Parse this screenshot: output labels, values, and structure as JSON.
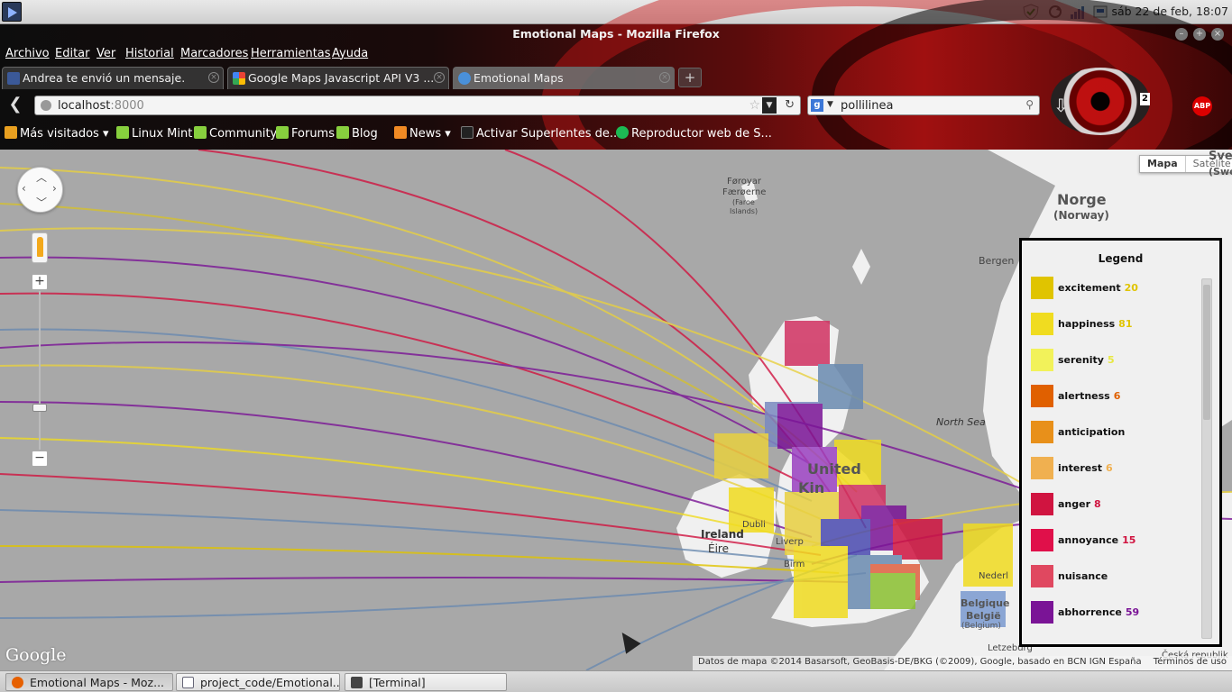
{
  "system": {
    "clock": "sáb 22 de feb, 18:07",
    "icons": [
      "mintmenu-icon",
      "shield-icon",
      "update-icon",
      "network-icon",
      "removable-drive-icon"
    ]
  },
  "window": {
    "title": "Emotional Maps - Mozilla Firefox"
  },
  "menubar": {
    "items": [
      "Archivo",
      "Editar",
      "Ver",
      "Historial",
      "Marcadores",
      "Herramientas",
      "Ayuda"
    ]
  },
  "tabs": [
    {
      "label": "Andrea te envió un mensaje.",
      "icon": "facebook-icon",
      "color": "#3b5998"
    },
    {
      "label": "Google Maps Javascript API V3 ...",
      "icon": "google-icon",
      "color": "#e8e8e8"
    },
    {
      "label": "Emotional Maps",
      "icon": "globe-icon",
      "color": "#4a90d9"
    }
  ],
  "newtab_label": "+",
  "navbar": {
    "url_host": "localhost",
    "url_port": ":8000",
    "search_value": "pollilinea",
    "search_engine": "g"
  },
  "bookmarks": [
    {
      "label": "Más visitados",
      "icon": "folder-icon",
      "color": "#e8a020",
      "dropdown": true
    },
    {
      "label": "Linux Mint",
      "icon": "mint-icon",
      "color": "#87cf3e"
    },
    {
      "label": "Community",
      "icon": "mint-icon",
      "color": "#87cf3e"
    },
    {
      "label": "Forums",
      "icon": "mint-icon",
      "color": "#87cf3e"
    },
    {
      "label": "Blog",
      "icon": "mint-icon",
      "color": "#87cf3e"
    },
    {
      "label": "News",
      "icon": "rss-icon",
      "color": "#f08a24",
      "dropdown": true
    },
    {
      "label": "Activar Superlentes de...",
      "icon": "page-icon",
      "color": "#222"
    },
    {
      "label": "Reproductor web de S...",
      "icon": "spotify-icon",
      "color": "#1db954"
    }
  ],
  "map": {
    "maptype": {
      "map": "Mapa",
      "satellite": "Satélite"
    },
    "labels": {
      "faroe": "Føroyar",
      "faroe2": "Færøerne",
      "faroe3": "(Faroe",
      "faroe4": "Islands)",
      "norway": "Norge",
      "norway2": "(Norway)",
      "sweden": "Sve",
      "sweden2": "(Swe",
      "bergen": "Bergen",
      "northsea": "North Sea",
      "ireland": "Ireland",
      "ireland2": "Éire",
      "united": "United",
      "kingdom": "Kin",
      "belgique": "Belgique",
      "belgie": "België",
      "belgium": "(Belgium)",
      "luxembourg": "Letzeburg",
      "dublin": "Dubli",
      "liverpool": "Liverp",
      "birmingham": "Birm",
      "nederland": "Nederl",
      "ceska": "Česká republik"
    },
    "logo": "Google",
    "attribution": "Datos de mapa ©2014 Basarsoft, GeoBasis-DE/BKG (©2009), Google, basado en BCN IGN España",
    "terms": "Términos de uso"
  },
  "legend": {
    "title": "Legend",
    "items": [
      {
        "name": "excitement",
        "count": "20",
        "color": "#e0c400"
      },
      {
        "name": "happiness",
        "count": "81",
        "color": "#f0dc20"
      },
      {
        "name": "serenity",
        "count": "5",
        "color": "#f2f25a"
      },
      {
        "name": "alertness",
        "count": "6",
        "color": "#e06000"
      },
      {
        "name": "anticipation",
        "count": "",
        "color": "#e8901a"
      },
      {
        "name": "interest",
        "count": "6",
        "color": "#f0b050"
      },
      {
        "name": "anger",
        "count": "8",
        "color": "#d01440"
      },
      {
        "name": "annoyance",
        "count": "15",
        "color": "#e0104a"
      },
      {
        "name": "nuisance",
        "count": "",
        "color": "#e04860"
      },
      {
        "name": "abhorrence",
        "count": "59",
        "color": "#7a1496"
      }
    ]
  },
  "taskbar": [
    {
      "label": "Emotional Maps - Moz...",
      "icon": "firefox-icon",
      "color": "#e66000",
      "active": true
    },
    {
      "label": "project_code/Emotional...",
      "icon": "window-icon",
      "color": "#667"
    },
    {
      "label": "[Terminal]",
      "icon": "terminal-icon",
      "color": "#444"
    }
  ]
}
